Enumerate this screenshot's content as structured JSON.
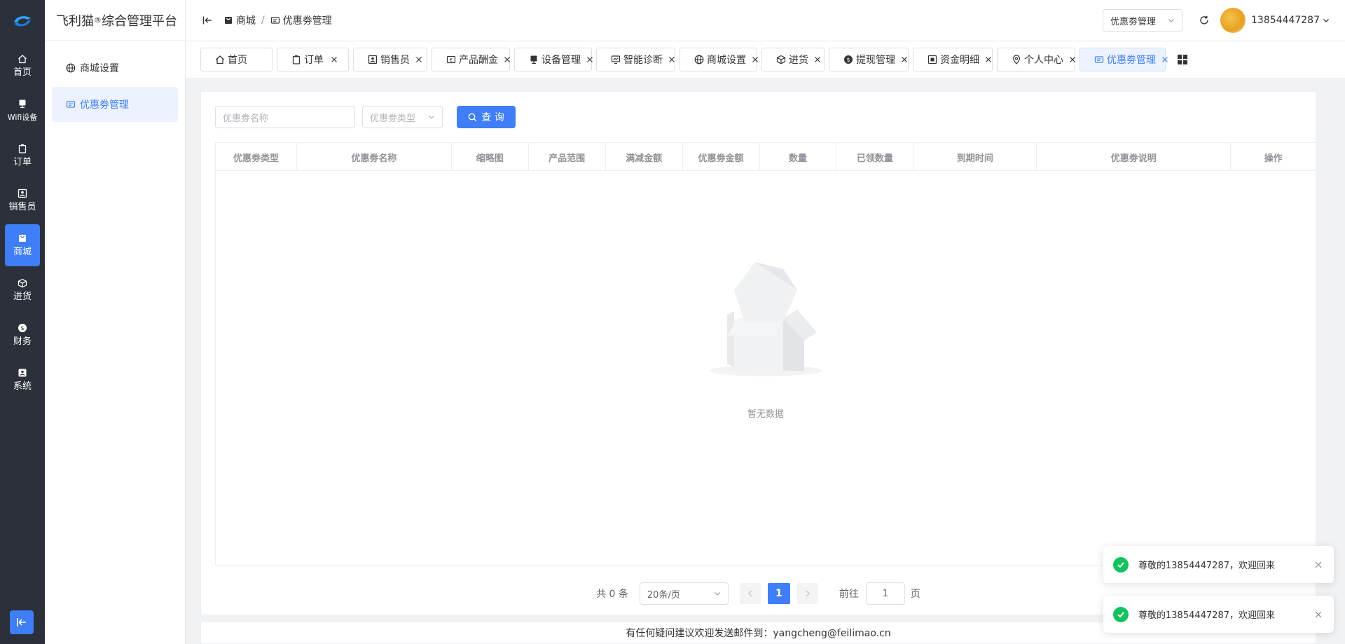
{
  "app": {
    "brand": "飞利猫",
    "brand_mark": "®",
    "brand_suffix": " 综合管理平台",
    "colors": {
      "accent": "#3f7ef6",
      "rail_bg": "#2b303b",
      "success": "#13c25e"
    }
  },
  "rail": {
    "logo_icon": "brand-logo-icon",
    "items": [
      {
        "label": "首页",
        "icon": "home-icon"
      },
      {
        "label": "Wifi设备",
        "icon": "device-icon"
      },
      {
        "label": "订单",
        "icon": "clipboard-icon"
      },
      {
        "label": "销售员",
        "icon": "user-card-icon"
      },
      {
        "label": "商城",
        "icon": "shop-icon",
        "active": true
      },
      {
        "label": "进货",
        "icon": "box-icon"
      },
      {
        "label": "财务",
        "icon": "coin-icon"
      },
      {
        "label": "系统",
        "icon": "system-icon"
      }
    ],
    "collapse_icon": "collapse-left-icon"
  },
  "side_menu": {
    "items": [
      {
        "label": "商城设置",
        "icon": "globe-icon"
      },
      {
        "label": "优惠劵管理",
        "icon": "ticket-icon",
        "active": true
      }
    ]
  },
  "header": {
    "breadcrumb": [
      {
        "label": "商城",
        "icon": "shop-icon"
      },
      {
        "label": "优惠劵管理",
        "icon": "ticket-icon"
      }
    ],
    "breadcrumb_sep": "/",
    "select_value": "优惠劵管理",
    "username": "13854447287"
  },
  "tabs": [
    {
      "label": "首页",
      "icon": "home-icon",
      "closable": false
    },
    {
      "label": "订单",
      "icon": "clipboard-icon",
      "closable": true
    },
    {
      "label": "销售员",
      "icon": "user-card-icon",
      "closable": true
    },
    {
      "label": "产品酬金",
      "icon": "money-icon",
      "closable": true
    },
    {
      "label": "设备管理",
      "icon": "device-icon",
      "closable": true
    },
    {
      "label": "智能诊断",
      "icon": "monitor-icon",
      "closable": true
    },
    {
      "label": "商城设置",
      "icon": "globe-icon",
      "closable": true
    },
    {
      "label": "进货",
      "icon": "box-icon",
      "closable": true
    },
    {
      "label": "提现管理",
      "icon": "coin-icon",
      "closable": true
    },
    {
      "label": "资金明细",
      "icon": "ledger-icon",
      "closable": true
    },
    {
      "label": "个人中心",
      "icon": "location-icon",
      "closable": true
    },
    {
      "label": "优惠劵管理",
      "icon": "ticket-icon",
      "closable": true,
      "active": true
    }
  ],
  "filters": {
    "name_placeholder": "优惠劵名称",
    "type_placeholder": "优惠劵类型",
    "query_label": "查 询"
  },
  "table": {
    "columns": [
      "优惠劵类型",
      "优惠劵名称",
      "缩略图",
      "产品范围",
      "满减金额",
      "优惠劵金额",
      "数量",
      "已领数量",
      "到期时间",
      "优惠劵说明",
      "操作"
    ],
    "empty_text": "暂无数据"
  },
  "pagination": {
    "total_text": "共 0 条",
    "page_size": "20条/页",
    "current_page": "1",
    "goto_label": "前往",
    "goto_value": "1",
    "page_unit": "页"
  },
  "footer": {
    "text": "有任何疑问建议欢迎发送邮件到：yangcheng@feilimao.cn"
  },
  "toasts": [
    {
      "message": "尊敬的13854447287，欢迎回来"
    },
    {
      "message": "尊敬的13854447287，欢迎回来"
    }
  ]
}
